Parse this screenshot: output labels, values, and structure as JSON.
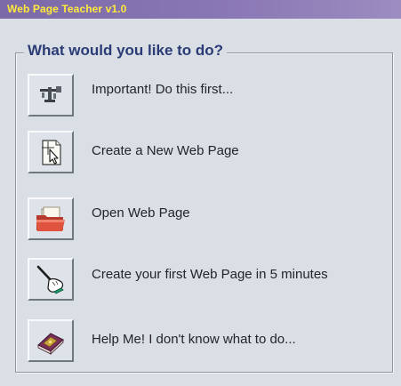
{
  "window": {
    "title": "Web Page Teacher v1.0"
  },
  "group": {
    "legend": "What would you like to do?"
  },
  "options": [
    {
      "label": "Important! Do this first...",
      "icon": "tools-icon"
    },
    {
      "label": "Create a New Web Page",
      "icon": "new-page-cursor-icon"
    },
    {
      "label": "Open Web Page",
      "icon": "open-folder-icon"
    },
    {
      "label": "Create your first Web Page in 5 minutes",
      "icon": "hand-wand-icon"
    },
    {
      "label": "Help Me! I don't know what to do...",
      "icon": "help-book-icon"
    }
  ],
  "colors": {
    "titlebar": "#8372b0",
    "title_text": "#ffea3a",
    "legend_text": "#2b3b76",
    "background": "#d9dfe4"
  }
}
